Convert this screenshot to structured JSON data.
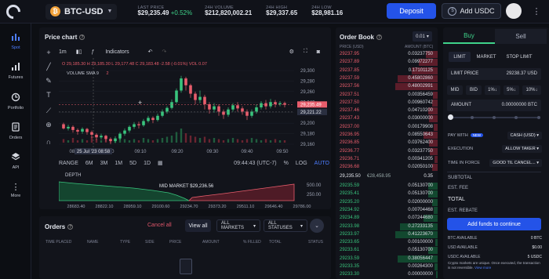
{
  "header": {
    "pair": "BTC-USD",
    "btc_symbol": "₿",
    "stats": [
      {
        "label": "LAST PRICE",
        "value": "$29,235.49",
        "change": "+0.52%"
      },
      {
        "label": "24H VOLUME",
        "value": "$212,820,002.21"
      },
      {
        "label": "24H HIGH",
        "value": "$29,337.65"
      },
      {
        "label": "24H LOW",
        "value": "$28,981.16"
      }
    ],
    "deposit_label": "Deposit",
    "add_usdc_label": "Add USDC",
    "usdc_symbol": "$"
  },
  "sidebar": {
    "items": [
      {
        "label": "Spot",
        "icon": "spot-chart-icon"
      },
      {
        "label": "Futures",
        "icon": "futures-bars-icon"
      },
      {
        "label": "Portfolio",
        "icon": "portfolio-clock-icon"
      },
      {
        "label": "Orders",
        "icon": "orders-doc-icon"
      },
      {
        "label": "API",
        "icon": "api-layers-icon"
      },
      {
        "label": "More",
        "icon": "more-dots-icon"
      }
    ]
  },
  "price_chart": {
    "title": "Price chart",
    "interval": "1m",
    "indicators_label": "Indicators",
    "ohlc_text": "O 29,185.30 H 29,185.30 L 29,177.48 C 29,183.48 -2.58 (-0.01%) VOL 0.07",
    "volume_text": "VOLUME SMA 9",
    "volume_value": "2",
    "y_ticks": [
      "29,300",
      "29,280",
      "29,260",
      "29,240",
      "29,220",
      "29,200",
      "29,180",
      "29,160"
    ],
    "x_ticks": [
      "08:50",
      "09:00",
      "09:10",
      "09:20",
      "09:30",
      "09:40",
      "09:50"
    ],
    "cursor_date": "25 Jul '23",
    "cursor_time": "08:58",
    "last_price_tag": "29,235.49",
    "cursor_price_tag": "29,221.22",
    "range_label": "RANGE",
    "ranges": [
      "6M",
      "3M",
      "1M",
      "5D",
      "1D"
    ],
    "clock": "09:44:43 (UTC-7)",
    "pct_label": "%",
    "log_label": "LOG",
    "auto_label": "AUTO",
    "candles": [
      [
        29198,
        29190,
        29201,
        29188
      ],
      [
        29190,
        29193,
        29197,
        29186
      ],
      [
        29193,
        29187,
        29196,
        29182
      ],
      [
        29187,
        29184,
        29190,
        29178
      ],
      [
        29184,
        29189,
        29192,
        29180
      ],
      [
        29189,
        29183,
        29191,
        29178
      ],
      [
        29183,
        29178,
        29186,
        29172
      ],
      [
        29178,
        29173,
        29181,
        29168
      ],
      [
        29173,
        29176,
        29180,
        29169
      ],
      [
        29176,
        29170,
        29178,
        29165
      ],
      [
        29170,
        29166,
        29173,
        29160
      ],
      [
        29166,
        29171,
        29175,
        29162
      ],
      [
        29171,
        29180,
        29183,
        29168
      ],
      [
        29180,
        29186,
        29190,
        29176
      ],
      [
        29186,
        29193,
        29196,
        29182
      ],
      [
        29193,
        29198,
        29202,
        29189
      ],
      [
        29198,
        29196,
        29203,
        29190
      ],
      [
        29196,
        29204,
        29208,
        29193
      ],
      [
        29204,
        29210,
        29214,
        29201
      ],
      [
        29210,
        29206,
        29213,
        29200
      ],
      [
        29206,
        29214,
        29218,
        29203
      ],
      [
        29214,
        29222,
        29226,
        29211
      ],
      [
        29222,
        29229,
        29232,
        29218
      ],
      [
        29229,
        29240,
        29245,
        29226
      ],
      [
        29240,
        29262,
        29266,
        29237
      ],
      [
        29262,
        29285,
        29290,
        29258
      ],
      [
        29285,
        29272,
        29288,
        29262
      ],
      [
        29272,
        29256,
        29275,
        29248
      ],
      [
        29256,
        29244,
        29260,
        29236
      ],
      [
        29244,
        29250,
        29262,
        29238
      ],
      [
        29250,
        29236,
        29254,
        29226
      ],
      [
        29236,
        29226,
        29240,
        29218
      ],
      [
        29226,
        29232,
        29238,
        29220
      ],
      [
        29232,
        29222,
        29236,
        29214
      ],
      [
        29222,
        29216,
        29226,
        29208
      ],
      [
        29216,
        29226,
        29230,
        29212
      ],
      [
        29226,
        29234,
        29238,
        29222
      ],
      [
        29234,
        29228,
        29240,
        29222
      ],
      [
        29228,
        29222,
        29232,
        29216
      ],
      [
        29222,
        29214,
        29226,
        29206
      ],
      [
        29214,
        29222,
        29226,
        29210
      ],
      [
        29222,
        29230,
        29236,
        29218
      ],
      [
        29230,
        29238,
        29242,
        29226
      ],
      [
        29238,
        29232,
        29244,
        29226
      ],
      [
        29232,
        29240,
        29246,
        29228
      ],
      [
        29240,
        29236,
        29244,
        29230
      ],
      [
        29236,
        29238,
        29242,
        29232
      ],
      [
        29238,
        29235,
        29241,
        29230
      ]
    ],
    "volumes": [
      3,
      2,
      4,
      2,
      3,
      2,
      5,
      3,
      2,
      4,
      3,
      2,
      5,
      3,
      2,
      3,
      2,
      4,
      3,
      2,
      3,
      4,
      5,
      6,
      9,
      12,
      8,
      6,
      5,
      4,
      5,
      3,
      4,
      3,
      2,
      3,
      4,
      3,
      2,
      3,
      4,
      3,
      2,
      3,
      2,
      3,
      2,
      2
    ]
  },
  "depth": {
    "title": "DEPTH",
    "mid_label": "MID MARKET",
    "mid_value": "$29,236.56",
    "y_ticks": [
      "500.00",
      "250.00"
    ],
    "x_ticks": [
      "28683.40",
      "28822.10",
      "28959.10",
      "29100.60",
      "29234.70",
      "29373.20",
      "29511.10",
      "29646.40",
      "29786.00"
    ]
  },
  "orders": {
    "title": "Orders",
    "cancel_all": "Cancel all",
    "view_all": "View all",
    "markets_filter": "ALL MARKETS",
    "status_filter": "ALL STATUSES",
    "columns": [
      "TIME PLACED",
      "NAME",
      "TYPE",
      "SIDE",
      "PRICE",
      "AMOUNT",
      "% FILLED",
      "TOTAL",
      "STATUS"
    ]
  },
  "order_book": {
    "title": "Order Book",
    "step": "0.01",
    "price_header": "PRICE (USD)",
    "amount_header": "AMOUNT (BTC)",
    "asks": [
      {
        "price": "29237.95",
        "amount": "0.03237750",
        "depth": 0.25
      },
      {
        "price": "29237.89",
        "amount": "0.09972277",
        "depth": 0.4
      },
      {
        "price": "29237.85",
        "amount": "0.17101125",
        "depth": 0.55
      },
      {
        "price": "29237.59",
        "amount": "0.45802860",
        "depth": 0.85
      },
      {
        "price": "29237.56",
        "amount": "0.48002991",
        "depth": 0.9
      },
      {
        "price": "29237.51",
        "amount": "0.00356459",
        "depth": 0.1
      },
      {
        "price": "29237.50",
        "amount": "0.00960742",
        "depth": 0.12
      },
      {
        "price": "29237.46",
        "amount": "0.04710200",
        "depth": 0.2
      },
      {
        "price": "29237.43",
        "amount": "0.03000000",
        "depth": 0.18
      },
      {
        "price": "29237.00",
        "amount": "0.00179908",
        "depth": 0.08
      },
      {
        "price": "29236.95",
        "amount": "0.08550643",
        "depth": 0.3
      },
      {
        "price": "29236.85",
        "amount": "0.03762400",
        "depth": 0.18
      },
      {
        "price": "29236.77",
        "amount": "0.03237750",
        "depth": 0.16
      },
      {
        "price": "29236.71",
        "amount": "0.00341205",
        "depth": 0.07
      },
      {
        "price": "29236.68",
        "amount": "0.02050100",
        "depth": 0.12
      }
    ],
    "spread_price": "29,235.50",
    "spread_usd": "€28,458.95",
    "spread_value": "0.35",
    "bids": [
      {
        "price": "29235.59",
        "amount": "0.05130700",
        "depth": 0.2
      },
      {
        "price": "29235.41",
        "amount": "0.05130700",
        "depth": 0.2
      },
      {
        "price": "29235.20",
        "amount": "0.02000000",
        "depth": 0.12
      },
      {
        "price": "29234.92",
        "amount": "0.00704468",
        "depth": 0.08
      },
      {
        "price": "29234.89",
        "amount": "0.07244680",
        "depth": 0.3
      },
      {
        "price": "29233.98",
        "amount": "0.27233135",
        "depth": 0.8
      },
      {
        "price": "29233.97",
        "amount": "0.41223670",
        "depth": 0.9
      },
      {
        "price": "29233.65",
        "amount": "0.00100000",
        "depth": 0.05
      },
      {
        "price": "29233.61",
        "amount": "0.05130700",
        "depth": 0.2
      },
      {
        "price": "29233.59",
        "amount": "0.38056447",
        "depth": 0.85
      },
      {
        "price": "29233.35",
        "amount": "0.00264300",
        "depth": 0.06
      },
      {
        "price": "29233.30",
        "amount": "0.00000000",
        "depth": 0.04
      }
    ]
  },
  "trade_form": {
    "buy_tab": "Buy",
    "sell_tab": "Sell",
    "order_types": [
      "LIMIT",
      "MARKET",
      "STOP LIMIT"
    ],
    "limit_price_label": "LIMIT PRICE",
    "limit_price_value": "29238.37 USD",
    "price_presets": [
      "MID",
      "BID",
      "1%↓",
      "5%↓",
      "10%↓"
    ],
    "amount_label": "AMOUNT",
    "amount_value": "0.00000000 BTC",
    "pay_with_label": "PAY WITH",
    "new_badge": "NEW",
    "pay_with_value": "CASH (USD)",
    "execution_label": "EXECUTION",
    "execution_value": "ALLOW TAKER",
    "tif_label": "TIME IN FORCE",
    "tif_value": "GOOD TIL CANCEL...",
    "subtotal_label": "SUBTOTAL",
    "est_fee_label": "EST. FEE",
    "total_label": "TOTAL",
    "est_rebate_label": "EST. REBATE",
    "add_funds_label": "Add funds to continue",
    "btc_available_label": "BTC AVAILABLE",
    "btc_available_value": "0 BTC",
    "usd_available_label": "USD AVAILABLE",
    "usd_available_value": "$0.00",
    "usdc_available_label": "USDC AVAILABLE",
    "usdc_available_value": "5 USDC",
    "note_text": "Crypto markets are unique. Once executed, the transaction is not reversible.",
    "note_link": "View more"
  },
  "colors": {
    "up": "#39c47d",
    "down": "#e85d6c",
    "accent": "#2453e8"
  }
}
